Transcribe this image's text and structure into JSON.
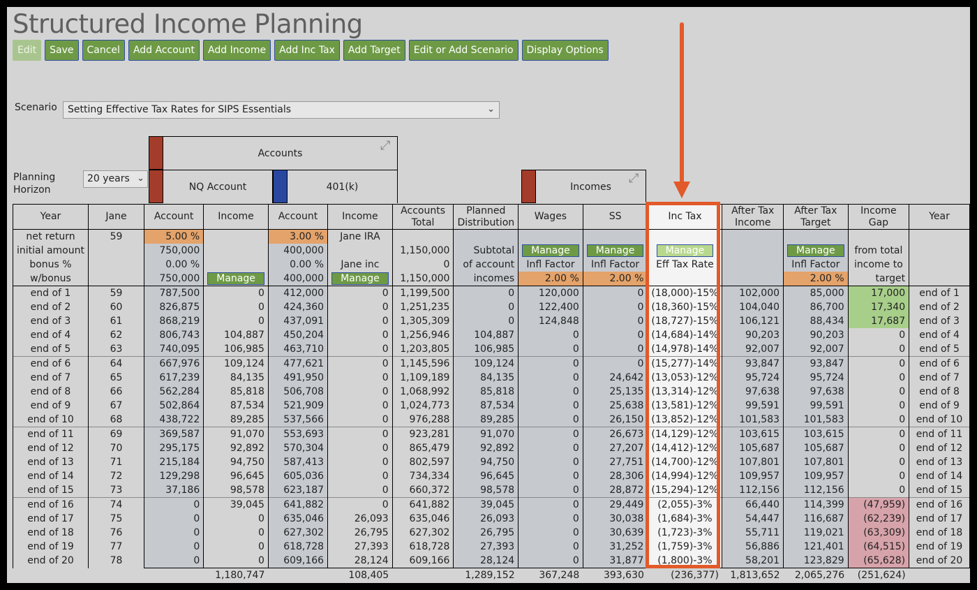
{
  "app": {
    "title": "Structured Income Planning"
  },
  "toolbar": {
    "edit": "Edit",
    "save": "Save",
    "cancel": "Cancel",
    "add_account": "Add Account",
    "add_income": "Add Income",
    "add_inc_tax": "Add Inc Tax",
    "add_target": "Add Target",
    "edit_scenario": "Edit or Add Scenario",
    "display_options": "Display Options"
  },
  "scenario": {
    "label": "Scenario",
    "value": "Setting Effective Tax Rates for SIPS Essentials"
  },
  "planning_horizon": {
    "label_line1": "Planning",
    "label_line2": "Horizon",
    "value": "20 years"
  },
  "groups": {
    "accounts": "Accounts",
    "nq_account": "NQ Account",
    "k401": "401(k)",
    "incomes": "Incomes"
  },
  "colors": {
    "accent_red": "#a33c2a",
    "accent_blue": "#2a47a0",
    "button_green": "#6e9a46",
    "highlight": "#e25a2a"
  },
  "headers": {
    "year": "Year",
    "jane": "Jane",
    "account": "Account",
    "income": "Income",
    "accounts_total_1": "Accounts",
    "accounts_total_2": "Total",
    "planned_dist_1": "Planned",
    "planned_dist_2": "Distribution",
    "wages": "Wages",
    "ss": "SS",
    "inc_tax": "Inc Tax",
    "after_tax_income_1": "After Tax",
    "after_tax_income_2": "Income",
    "after_tax_target_1": "After Tax",
    "after_tax_target_2": "Target",
    "income_gap_1": "Income",
    "income_gap_2": "Gap",
    "year_end": "Year"
  },
  "params": {
    "labels": [
      "net return",
      "initial amount",
      "bonus %",
      "w/bonus"
    ],
    "jane_age": "59",
    "nq_net_return": "5.00  %",
    "nq_initial": "750,000",
    "nq_bonus": "0.00  %",
    "nq_wbonus": "750,000",
    "k401_net_return": "3.00  %",
    "k401_initial": "400,000",
    "k401_bonus": "0.00  %",
    "k401_wbonus": "400,000",
    "jane_ira": "Jane IRA",
    "jane_inc": "Jane inc",
    "total_initial": "1,150,000",
    "total_bonus": "0",
    "total_wbonus": "1,150,000",
    "subtotal_1": "Subtotal",
    "subtotal_2": "of account",
    "subtotal_3": "incomes",
    "manage": "Manage",
    "infl_factor": "Infl Factor",
    "infl_value": "2.00  %",
    "eff_tax_rate": "Eff Tax Rate",
    "gap_1": "from total",
    "gap_2": "income to",
    "gap_3": "target"
  },
  "rows": [
    [
      "end of 1",
      "59",
      "787,500",
      "0",
      "412,000",
      "0",
      "1,199,500",
      "0",
      "120,000",
      "0",
      "(18,000)-15%",
      "102,000",
      "85,000",
      "17,000",
      "end of 1"
    ],
    [
      "end of 2",
      "60",
      "826,875",
      "0",
      "424,360",
      "0",
      "1,251,235",
      "0",
      "122,400",
      "0",
      "(18,360)-15%",
      "104,040",
      "86,700",
      "17,340",
      "end of 2"
    ],
    [
      "end of 3",
      "61",
      "868,219",
      "0",
      "437,091",
      "0",
      "1,305,309",
      "0",
      "124,848",
      "0",
      "(18,727)-15%",
      "106,121",
      "88,434",
      "17,687",
      "end of 3"
    ],
    [
      "end of 4",
      "62",
      "806,743",
      "104,887",
      "450,204",
      "0",
      "1,256,946",
      "104,887",
      "0",
      "0",
      "(14,684)-14%",
      "90,203",
      "90,203",
      "0",
      "end of 4"
    ],
    [
      "end of 5",
      "63",
      "740,095",
      "106,985",
      "463,710",
      "0",
      "1,203,805",
      "106,985",
      "0",
      "0",
      "(14,978)-14%",
      "92,007",
      "92,007",
      "0",
      "end of 5"
    ],
    [
      "end of 6",
      "64",
      "667,976",
      "109,124",
      "477,621",
      "0",
      "1,145,596",
      "109,124",
      "0",
      "0",
      "(15,277)-14%",
      "93,847",
      "93,847",
      "0",
      "end of 6"
    ],
    [
      "end of 7",
      "65",
      "617,239",
      "84,135",
      "491,950",
      "0",
      "1,109,189",
      "84,135",
      "0",
      "24,642",
      "(13,053)-12%",
      "95,724",
      "95,724",
      "0",
      "end of 7"
    ],
    [
      "end of 8",
      "66",
      "562,284",
      "85,818",
      "506,708",
      "0",
      "1,068,992",
      "85,818",
      "0",
      "25,135",
      "(13,314)-12%",
      "97,638",
      "97,638",
      "0",
      "end of 8"
    ],
    [
      "end of 9",
      "67",
      "502,864",
      "87,534",
      "521,909",
      "0",
      "1,024,773",
      "87,534",
      "0",
      "25,638",
      "(13,581)-12%",
      "99,591",
      "99,591",
      "0",
      "end of 9"
    ],
    [
      "end of 10",
      "68",
      "438,722",
      "89,285",
      "537,566",
      "0",
      "976,288",
      "89,285",
      "0",
      "26,150",
      "(13,852)-12%",
      "101,583",
      "101,583",
      "0",
      "end of 10"
    ],
    [
      "end of 11",
      "69",
      "369,587",
      "91,070",
      "553,693",
      "0",
      "923,281",
      "91,070",
      "0",
      "26,673",
      "(14,129)-12%",
      "103,615",
      "103,615",
      "0",
      "end of 11"
    ],
    [
      "end of 12",
      "70",
      "295,175",
      "92,892",
      "570,304",
      "0",
      "865,479",
      "92,892",
      "0",
      "27,207",
      "(14,412)-12%",
      "105,687",
      "105,687",
      "0",
      "end of 12"
    ],
    [
      "end of 13",
      "71",
      "215,184",
      "94,750",
      "587,413",
      "0",
      "802,597",
      "94,750",
      "0",
      "27,751",
      "(14,700)-12%",
      "107,801",
      "107,801",
      "0",
      "end of 13"
    ],
    [
      "end of 14",
      "72",
      "129,298",
      "96,645",
      "605,036",
      "0",
      "734,334",
      "96,645",
      "0",
      "28,306",
      "(14,994)-12%",
      "109,957",
      "109,957",
      "0",
      "end of 14"
    ],
    [
      "end of 15",
      "73",
      "37,186",
      "98,578",
      "623,187",
      "0",
      "660,372",
      "98,578",
      "0",
      "28,872",
      "(15,294)-12%",
      "112,156",
      "112,156",
      "0",
      "end of 15"
    ],
    [
      "end of 16",
      "74",
      "0",
      "39,045",
      "641,882",
      "0",
      "641,882",
      "39,045",
      "0",
      "29,449",
      "(2,055)-3%",
      "66,440",
      "114,399",
      "(47,959)",
      "end of 16"
    ],
    [
      "end of 17",
      "75",
      "0",
      "0",
      "635,046",
      "26,093",
      "635,046",
      "26,093",
      "0",
      "30,038",
      "(1,684)-3%",
      "54,447",
      "116,687",
      "(62,239)",
      "end of 17"
    ],
    [
      "end of 18",
      "76",
      "0",
      "0",
      "627,302",
      "26,795",
      "627,302",
      "26,795",
      "0",
      "30,639",
      "(1,723)-3%",
      "55,711",
      "119,021",
      "(63,309)",
      "end of 18"
    ],
    [
      "end of 19",
      "77",
      "0",
      "0",
      "618,728",
      "27,393",
      "618,728",
      "27,393",
      "0",
      "31,252",
      "(1,759)-3%",
      "56,886",
      "121,401",
      "(64,515)",
      "end of 19"
    ],
    [
      "end of 20",
      "78",
      "0",
      "0",
      "609,166",
      "28,124",
      "609,166",
      "28,124",
      "0",
      "31,877",
      "(1,800)-3%",
      "58,201",
      "123,829",
      "(65,628)",
      "end of 20"
    ]
  ],
  "totals": [
    "",
    "",
    "",
    "1,180,747",
    "",
    "108,405",
    "",
    "1,289,152",
    "367,248",
    "393,630",
    "(236,377)",
    "1,813,652",
    "2,065,276",
    "(251,624)",
    ""
  ]
}
